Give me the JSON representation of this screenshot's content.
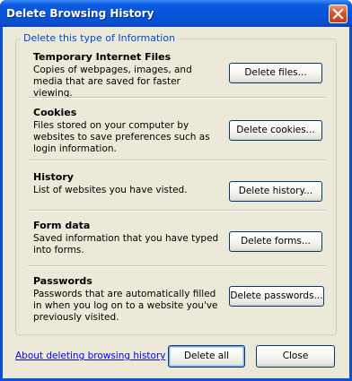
{
  "window": {
    "title": "Delete Browsing History"
  },
  "group": {
    "legend": "Delete this type of Information"
  },
  "sections": [
    {
      "title": "Temporary Internet Files",
      "description": "Copies of webpages, images, and media that are saved for faster viewing.",
      "button": "Delete files..."
    },
    {
      "title": "Cookies",
      "description": "Files stored on your computer by websites to save preferences such as login information.",
      "button": "Delete cookies..."
    },
    {
      "title": "History",
      "description": "List of websites you have visted.",
      "button": "Delete history..."
    },
    {
      "title": "Form data",
      "description": "Saved information that you have typed into forms.",
      "button": "Delete forms..."
    },
    {
      "title": "Passwords",
      "description": "Passwords that are automatically filled in when you log on to a website you've previously visited.",
      "button": "Delete passwords..."
    }
  ],
  "footer": {
    "about_link": "About deleting browsing history",
    "delete_all": "Delete all",
    "close": "Close"
  },
  "colors": {
    "titlebar": "#0553d6",
    "dialog_background": "#ece9d8",
    "legend_text": "#0046d5",
    "link": "#0000ff",
    "close_button": "#d8532c"
  },
  "icons": {
    "close": "close-icon"
  }
}
